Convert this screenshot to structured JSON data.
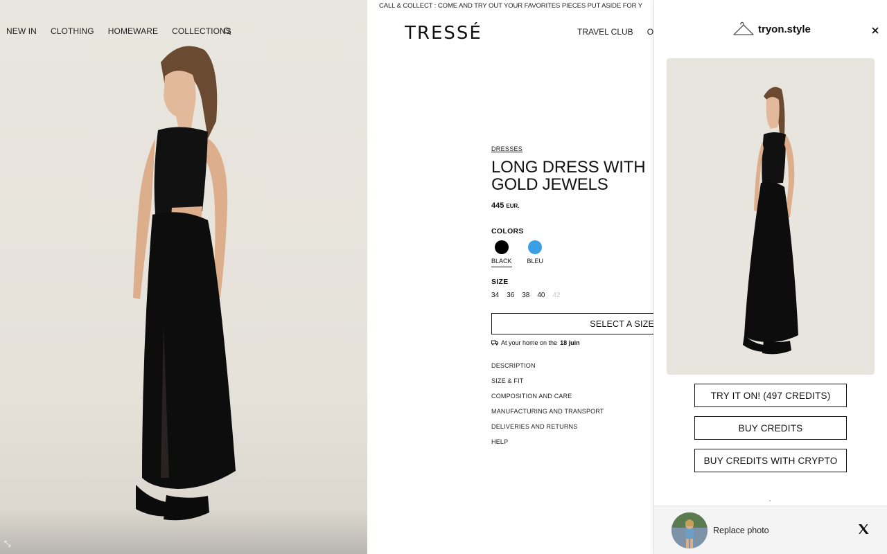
{
  "announcement": "CALL & COLLECT : COME AND TRY OUT YOUR FAVORITES PIECES PUT ASIDE FOR Y",
  "nav_left": [
    "NEW IN",
    "CLOTHING",
    "HOMEWARE",
    "COLLECTIONS"
  ],
  "logo": "TRESSÉ",
  "nav_right": [
    "TRAVEL CLUB",
    "OUR"
  ],
  "product": {
    "category": "DRESSES",
    "title": "LONG DRESS WITH GOLD JEWELS",
    "price": "445",
    "currency": "EUR.",
    "colors_label": "COLORS",
    "colors": [
      {
        "name": "BLACK",
        "hex": "#000000",
        "selected": true
      },
      {
        "name": "BLEU",
        "hex": "#3b9fe3",
        "selected": false
      }
    ],
    "size_label": "SIZE",
    "sizes": [
      {
        "label": "34",
        "available": true
      },
      {
        "label": "36",
        "available": true
      },
      {
        "label": "38",
        "available": true
      },
      {
        "label": "40",
        "available": true
      },
      {
        "label": "42",
        "available": false
      }
    ],
    "select_button": "SELECT A SIZE",
    "delivery_prefix": "At your home on the",
    "delivery_date": "18 juin",
    "accordion": [
      "DESCRIPTION",
      "SIZE & FIT",
      "COMPOSITION AND CARE",
      "MANUFACTURING AND TRANSPORT",
      "DELIVERIES AND RETURNS",
      "HELP"
    ]
  },
  "tryon": {
    "brand": "tryon.style",
    "try_button": "TRY IT ON! (497 CREDITS)",
    "buy_button": "BUY CREDITS",
    "crypto_button": "BUY CREDITS WITH CRYPTO",
    "replace_label": "Replace photo"
  },
  "icons": [
    "search-icon",
    "close-icon",
    "hanger-icon",
    "x-logo-icon",
    "truck-icon",
    "expand-icon"
  ]
}
